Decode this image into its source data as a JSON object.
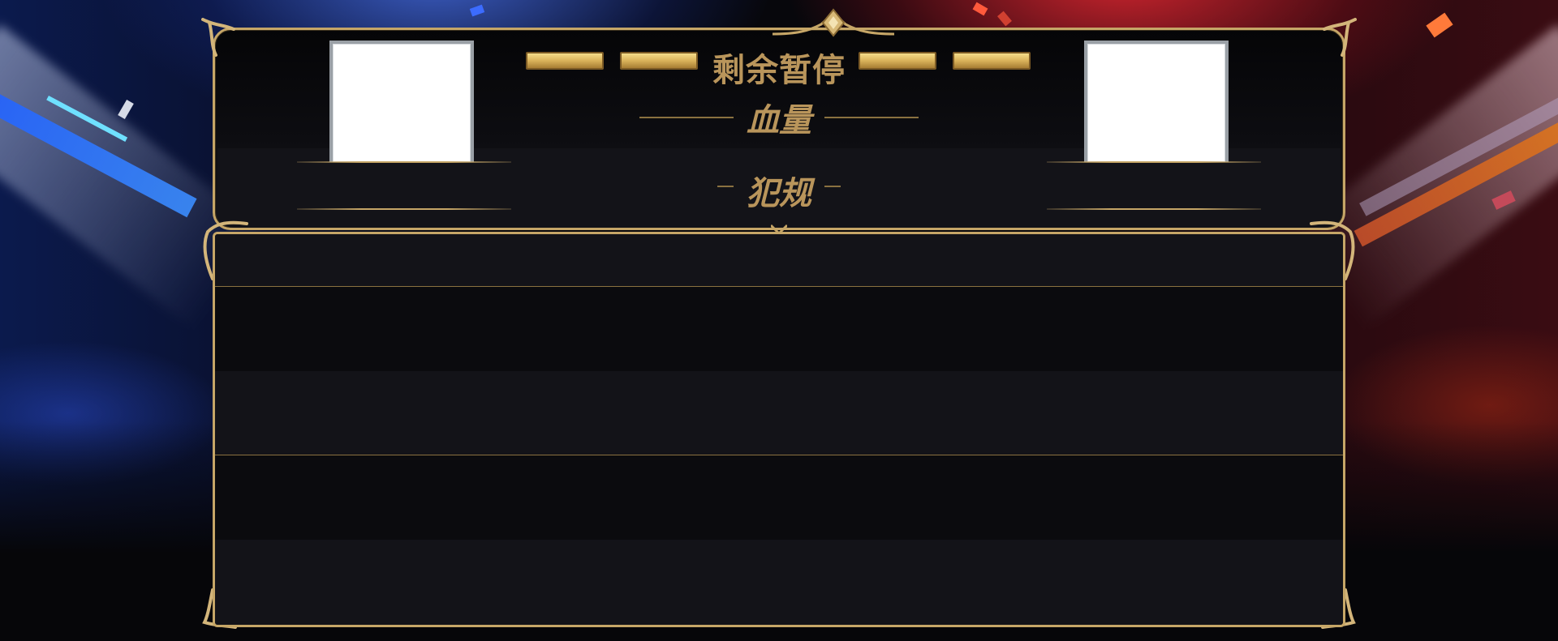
{
  "header": {
    "pause_title": "剩余暂停",
    "hp_label": "血量",
    "foul_label": "犯规"
  },
  "teams": {
    "left": {
      "pauses_remaining": 2
    },
    "right": {
      "pauses_remaining": 2
    }
  },
  "colors": {
    "gold": "#c6a667",
    "label_gold": "#b9955b",
    "panel_dark": "#0b0b0e",
    "panel_band": "#131318",
    "blue_side": "#1f5cff",
    "red_side": "#e03040"
  }
}
